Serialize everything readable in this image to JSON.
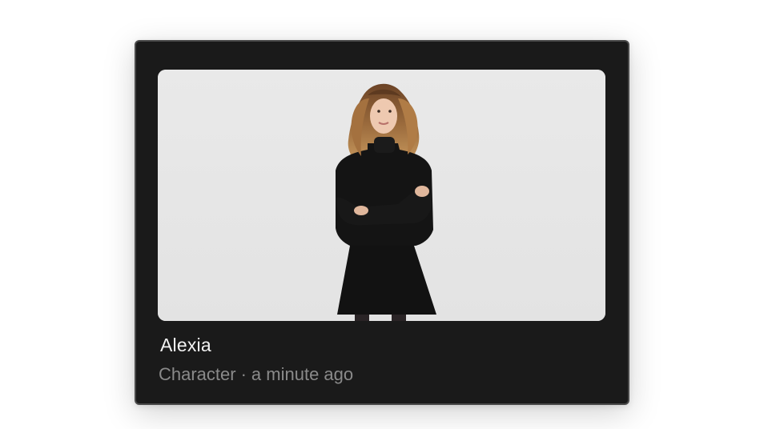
{
  "card": {
    "title": "Alexia",
    "type": "Character",
    "separator": "·",
    "timestamp": "a minute ago",
    "image_icon": "character-portrait-image"
  },
  "colors": {
    "card_background": "#1a1a1a",
    "image_background": "#e6e6e6",
    "title": "#f2f2f2",
    "meta": "#8a8a8a"
  }
}
